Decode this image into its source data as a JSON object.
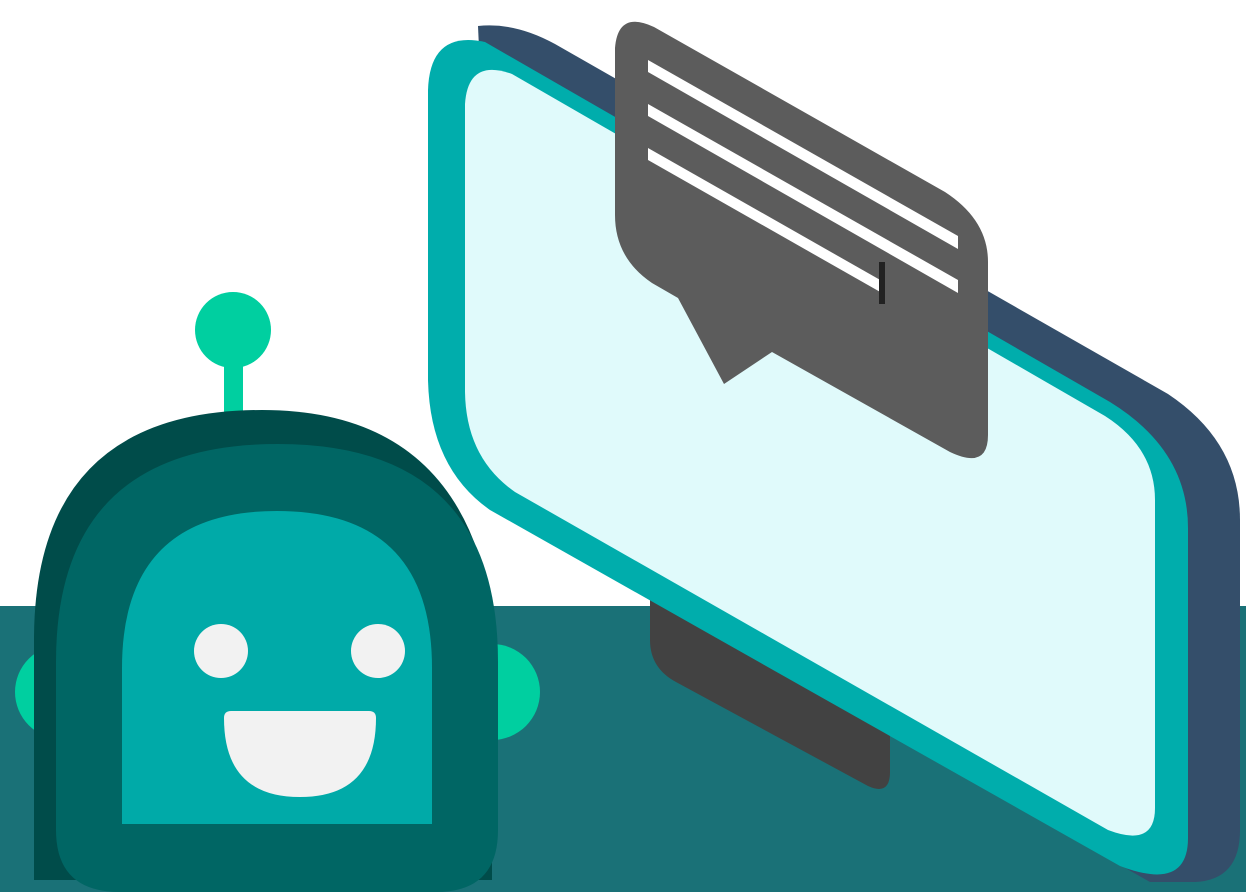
{
  "colors": {
    "background": "#ffffff",
    "floor": "#1a7177",
    "monitor_shadow": "#344e6a",
    "monitor_frame": "#00adac",
    "monitor_screen": "#e0fafb",
    "monitor_stand": "#424242",
    "bubble": "#5c5c5c",
    "bubble_lines": "#ffffff",
    "text_cursor": "#222222",
    "robot_outline": "#004c4a",
    "robot_body": "#006664",
    "robot_face": "#00aaa8",
    "robot_accent": "#00cfa0",
    "robot_eyes": "#f2f2f2",
    "robot_mouth": "#f2f2f2"
  },
  "icons": {
    "robot": "robot-mascot-icon",
    "monitor": "monitor-icon",
    "bubble": "chat-bubble-icon",
    "cursor": "text-cursor-icon"
  }
}
